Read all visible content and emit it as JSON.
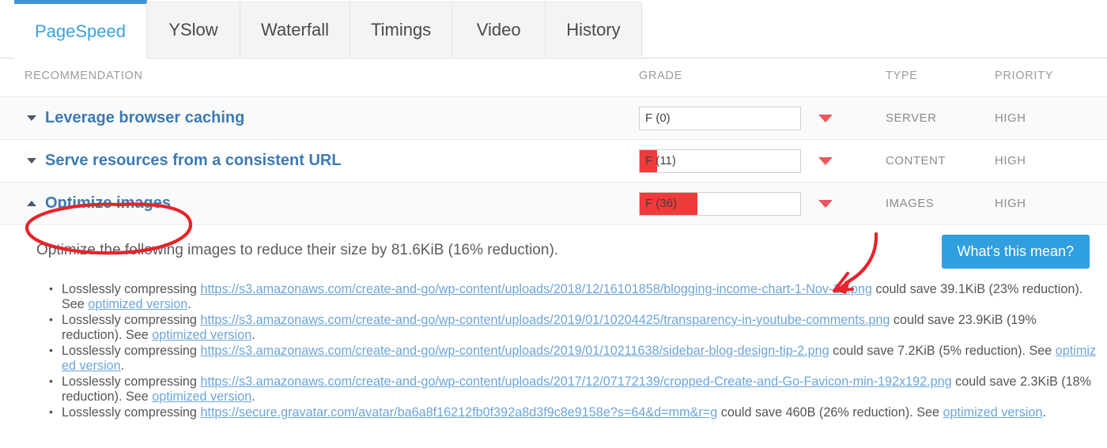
{
  "tabs": [
    {
      "label": "PageSpeed",
      "active": true
    },
    {
      "label": "YSlow",
      "active": false
    },
    {
      "label": "Waterfall",
      "active": false
    },
    {
      "label": "Timings",
      "active": false
    },
    {
      "label": "Video",
      "active": false
    },
    {
      "label": "History",
      "active": false
    }
  ],
  "columns": {
    "recommendation": "RECOMMENDATION",
    "grade": "GRADE",
    "type": "TYPE",
    "priority": "PRIORITY"
  },
  "rows": [
    {
      "title": "Leverage browser caching",
      "caret": "down",
      "grade_label": "F (0)",
      "grade_percent": 0,
      "type": "SERVER",
      "priority": "HIGH"
    },
    {
      "title": "Serve resources from a consistent URL",
      "caret": "down",
      "grade_label": "F (11)",
      "grade_percent": 11,
      "type": "CONTENT",
      "priority": "HIGH"
    },
    {
      "title": "Optimize images",
      "caret": "up",
      "grade_label": "F (36)",
      "grade_percent": 36,
      "type": "IMAGES",
      "priority": "HIGH"
    }
  ],
  "detail": {
    "summary": "Optimize the following images to reduce their size by 81.6KiB (16% reduction).",
    "whats_this_label": "What's this mean?",
    "link_label": "optimized version",
    "items": [
      {
        "prefix": "Losslessly compressing ",
        "url": "https://s3.amazonaws.com/create-and-go/wp-content/uploads/2018/12/16101858/blogging-income-chart-1-Nov-18.png",
        "middle": " could save 39.1KiB (23% reduction). See ",
        "link": "optimized version",
        "suffix": "."
      },
      {
        "prefix": "Losslessly compressing ",
        "url": "https://s3.amazonaws.com/create-and-go/wp-content/uploads/2019/01/10204425/transparency-in-youtube-comments.png",
        "middle": " could save 23.9KiB (19% reduction). See ",
        "link": "optimized version",
        "suffix": "."
      },
      {
        "prefix": "Losslessly compressing ",
        "url": "https://s3.amazonaws.com/create-and-go/wp-content/uploads/2019/01/10211638/sidebar-blog-design-tip-2.png",
        "middle": " could save 7.2KiB (5% reduction). See ",
        "link": "optimized version",
        "suffix": "."
      },
      {
        "prefix": "Losslessly compressing ",
        "url": "https://s3.amazonaws.com/create-and-go/wp-content/uploads/2017/12/07172139/cropped-Create-and-Go-Favicon-min-192x192.png",
        "middle": " could save 2.3KiB (18% reduction). See ",
        "link": "optimized version",
        "suffix": "."
      },
      {
        "prefix": "Losslessly compressing ",
        "url": "https://secure.gravatar.com/avatar/ba6a8f16212fb0f392a8d3f9c8e9158e?s=64&d=mm&r=g",
        "middle": " could save 460B (26% reduction). See ",
        "link": "optimized version",
        "suffix": "."
      }
    ]
  },
  "colors": {
    "accent_blue": "#3b93d4",
    "link_blue": "#6ca5d8",
    "title_blue": "#3d7ab3",
    "grade_red": "#ef3b39",
    "annotation_red": "#e8232a",
    "button_blue": "#2f9fe0"
  }
}
